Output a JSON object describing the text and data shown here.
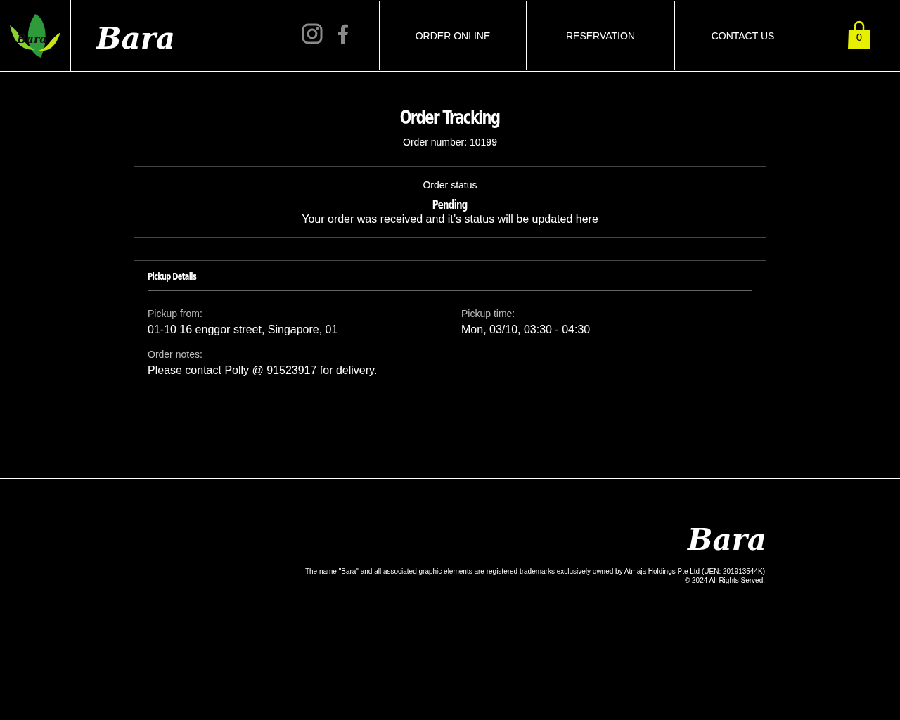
{
  "header": {
    "logo_text": "Bara",
    "brand": "Bara",
    "nav": [
      {
        "label": "ORDER ONLINE"
      },
      {
        "label": "RESERVATION"
      },
      {
        "label": "CONTACT US"
      }
    ],
    "cart_count": "0"
  },
  "tracking": {
    "title": "Order Tracking",
    "order_number_label": "Order number:",
    "order_number": "10199"
  },
  "status": {
    "label": "Order status",
    "value": "Pending",
    "message": "Your order was received and it’s status will be updated here"
  },
  "pickup": {
    "title": "Pickup Details",
    "fields": [
      {
        "label": "Pickup from:",
        "value": "01-10 16 enggor street, Singapore, 01"
      },
      {
        "label": "Pickup time:",
        "value": "Mon, 03/10, 03:30 - 04:30"
      }
    ],
    "notes_label": "Order notes:",
    "notes": "Please contact Polly @ 91523917 for delivery."
  },
  "footer": {
    "brand": "Bara",
    "legal": "The name \"Bara\" and all associated graphic elements are registered trademarks exclusively owned by Atmaja Holdings Pte Ltd (UEN: 201913544K)",
    "copyright": "© 2024 All Rights Served."
  }
}
